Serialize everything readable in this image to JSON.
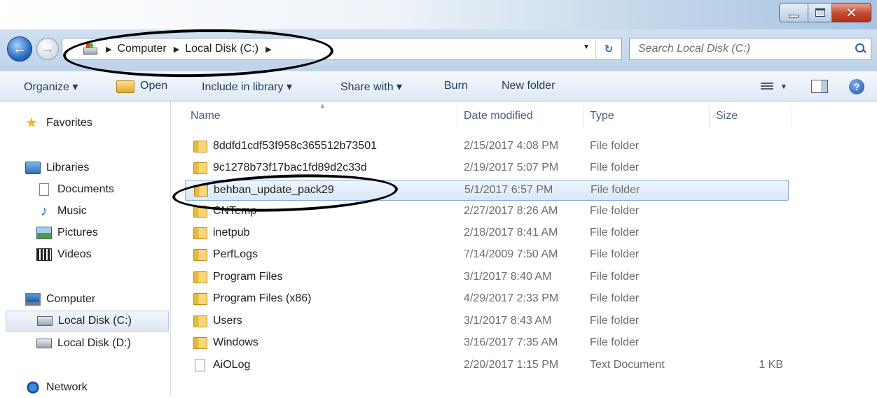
{
  "window": {
    "controls": {
      "minimize_icon": "minimize-icon",
      "maximize_icon": "maximize-icon",
      "close_label": "✕"
    }
  },
  "address": {
    "back_icon": "back-arrow-icon",
    "forward_icon": "forward-arrow-icon",
    "location_icon": "drive-icon",
    "crumbs": [
      "Computer",
      "Local Disk (C:)"
    ],
    "refresh_label": "↻",
    "search_placeholder": "Search Local Disk (C:)"
  },
  "toolbar": {
    "organize_label": "Organize ▾",
    "open_label": "Open",
    "include_label": "Include in library ▾",
    "share_label": "Share with ▾",
    "burn_label": "Burn",
    "new_folder_label": "New folder",
    "help_label": "?"
  },
  "sidebar": {
    "favorites": "Favorites",
    "libraries": "Libraries",
    "documents": "Documents",
    "music": "Music",
    "pictures": "Pictures",
    "videos": "Videos",
    "computer": "Computer",
    "local_c": "Local Disk (C:)",
    "local_d": "Local Disk (D:)",
    "network": "Network"
  },
  "columns": {
    "name": "Name",
    "date": "Date modified",
    "type": "Type",
    "size": "Size"
  },
  "files": [
    {
      "name": "8ddfd1cdf53f958c365512b73501",
      "date": "2/15/2017 4:08 PM",
      "type": "File folder",
      "size": ""
    },
    {
      "name": "9c1278b73f17bac1fd89d2c33d",
      "date": "2/19/2017 5:07 PM",
      "type": "File folder",
      "size": ""
    },
    {
      "name": "behban_update_pack29",
      "date": "5/1/2017 6:57 PM",
      "type": "File folder",
      "size": ""
    },
    {
      "name": "CNTemp",
      "date": "2/27/2017 8:26 AM",
      "type": "File folder",
      "size": ""
    },
    {
      "name": "inetpub",
      "date": "2/18/2017 8:41 AM",
      "type": "File folder",
      "size": ""
    },
    {
      "name": "PerfLogs",
      "date": "7/14/2009 7:50 AM",
      "type": "File folder",
      "size": ""
    },
    {
      "name": "Program Files",
      "date": "3/1/2017 8:40 AM",
      "type": "File folder",
      "size": ""
    },
    {
      "name": "Program Files (x86)",
      "date": "4/29/2017 2:33 PM",
      "type": "File folder",
      "size": ""
    },
    {
      "name": "Users",
      "date": "3/1/2017 8:43 AM",
      "type": "File folder",
      "size": ""
    },
    {
      "name": "Windows",
      "date": "3/16/2017 7:35 AM",
      "type": "File folder",
      "size": ""
    },
    {
      "name": "AiOLog",
      "date": "2/20/2017 1:15 PM",
      "type": "Text Document",
      "size": "1 KB"
    }
  ],
  "selected_file": "behban_update_pack29",
  "colors": {
    "selection_border": "#84acdd",
    "annotation": "#000000"
  }
}
